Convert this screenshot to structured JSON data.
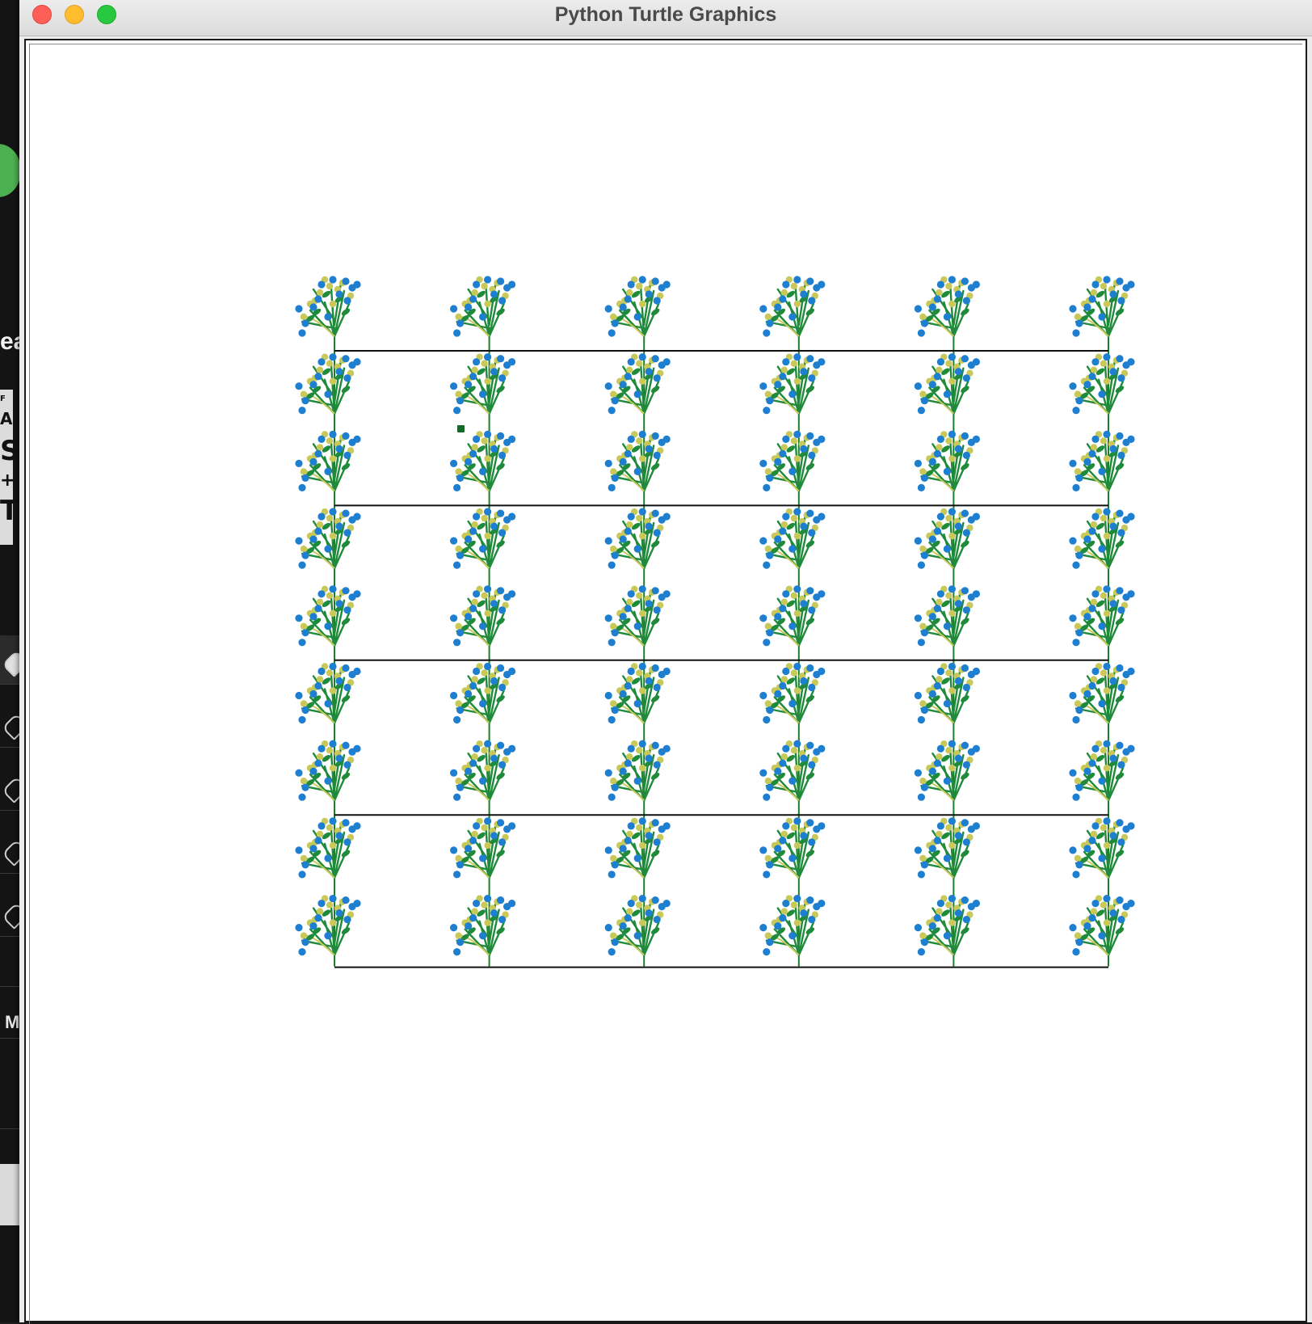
{
  "window": {
    "title": "Python Turtle Graphics",
    "controls": [
      "close",
      "minimize",
      "zoom"
    ]
  },
  "background_app": {
    "partial_texts": [
      "ea",
      "M"
    ]
  },
  "drawing": {
    "grid": {
      "columns": 6,
      "rows": 9,
      "bands": 4
    },
    "colors": {
      "line": "#111111",
      "stem": "#1b7f2a",
      "leaf": "#1f8a3a",
      "blossom_blue": "#1e7fd0",
      "blossom_yellow": "#c9c95a",
      "cursor": "#14692a"
    },
    "motif": "flower-sprig",
    "cursor_icon": "turtle-cursor-square"
  }
}
